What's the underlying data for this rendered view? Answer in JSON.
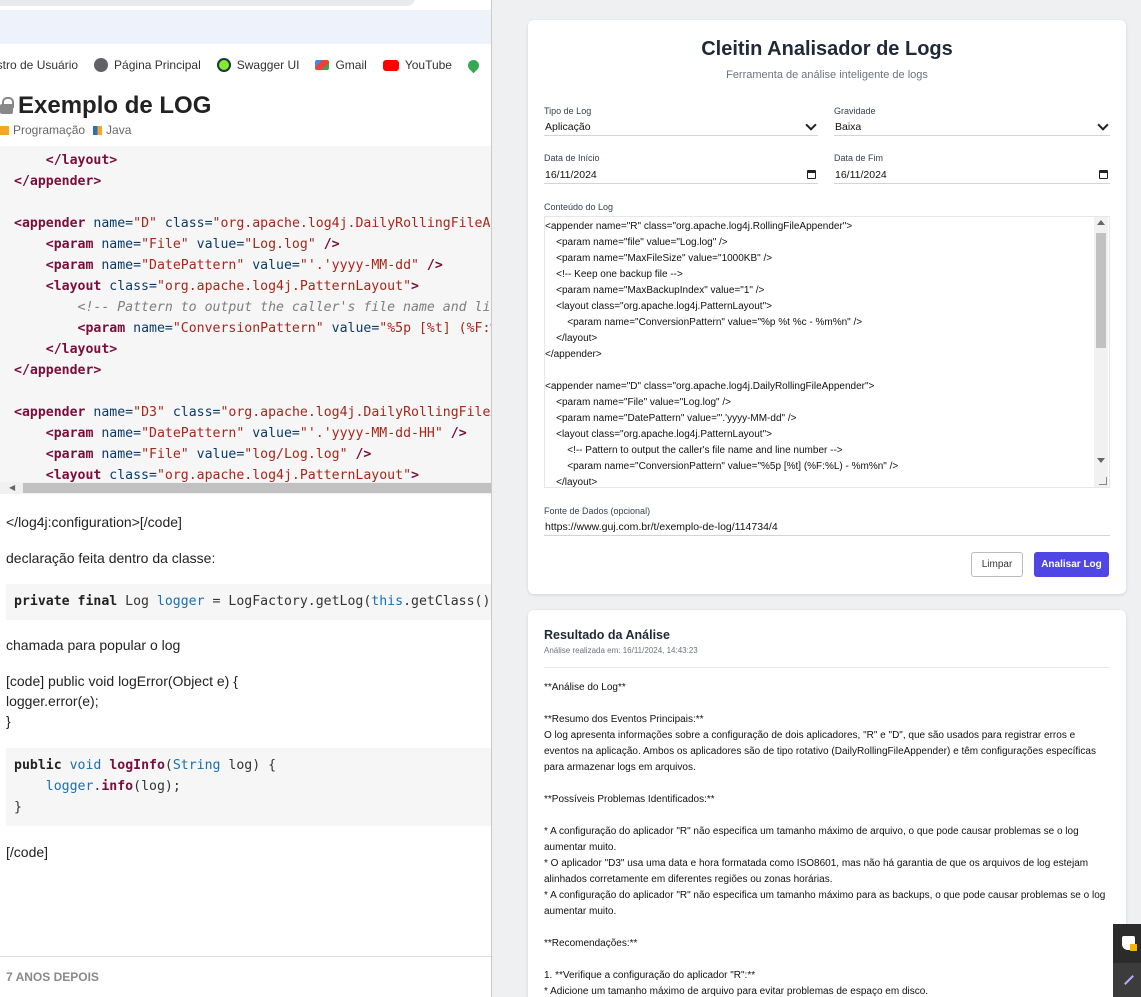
{
  "bookmarks": [
    {
      "label": "astro de Usuário",
      "icon": "user-icon",
      "color": "#5f6368"
    },
    {
      "label": "Página Principal",
      "icon": "globe-icon",
      "color": "#5f6368"
    },
    {
      "label": "Swagger UI",
      "icon": "swagger-icon",
      "color": "#85ea2d"
    },
    {
      "label": "Gmail",
      "icon": "gmail-icon",
      "color": "#ea4335"
    },
    {
      "label": "YouTube",
      "icon": "youtube-icon",
      "color": "#ff0000"
    }
  ],
  "post": {
    "title": "Exemplo de LOG",
    "categories": [
      {
        "label": "Programação",
        "color": "#f5a623"
      },
      {
        "label": "Java",
        "color": "#2f6fb6"
      }
    ],
    "p1": "</log4j:configuration>[/code]",
    "p2": "declaração feita dentro da classe:",
    "p3": "chamada para popular o log",
    "p4a": "[code] public void logError(Object e) {",
    "p4b": "logger.error(e);",
    "p4c": "}",
    "p5": "[/code]",
    "years_later": "7 ANOS DEPOIS"
  },
  "app": {
    "title": "Cleitin Analisador de Logs",
    "subtitle": "Ferramenta de análise inteligente de logs",
    "log_type_label": "Tipo de Log",
    "log_type_value": "Aplicação",
    "severity_label": "Gravidade",
    "severity_value": "Baixa",
    "start_label": "Data de Início",
    "start_value": "16/11/2024",
    "end_label": "Data de Fim",
    "end_value": "16/11/2024",
    "content_label": "Conteúdo do Log",
    "content_value": "<appender name=\"R\" class=\"org.apache.log4j.RollingFileAppender\">\n    <param name=\"file\" value=\"Log.log\" />\n    <param name=\"MaxFileSize\" value=\"1000KB\" />\n    <!-- Keep one backup file -->\n    <param name=\"MaxBackupIndex\" value=\"1\" />\n    <layout class=\"org.apache.log4j.PatternLayout\">\n        <param name=\"ConversionPattern\" value=\"%p %t %c - %m%n\" />\n    </layout>\n</appender>\n\n<appender name=\"D\" class=\"org.apache.log4j.DailyRollingFileAppender\">\n    <param name=\"File\" value=\"Log.log\" />\n    <param name=\"DatePattern\" value=\"'.'yyyy-MM-dd\" />\n    <layout class=\"org.apache.log4j.PatternLayout\">\n        <!-- Pattern to output the caller's file name and line number -->\n        <param name=\"ConversionPattern\" value=\"%5p [%t] (%F:%L) - %m%n\" />\n    </layout>",
    "source_label": "Fonte de Dados (opcional)",
    "source_value": "https://www.guj.com.br/t/exemplo-de-log/114734/4",
    "clear_label": "Limpar",
    "analyze_label": "Analisar Log",
    "accent": "#4f46e5"
  },
  "result": {
    "title": "Resultado da Análise",
    "timestamp": "Análise realizada em: 16/11/2024, 14:43:23",
    "body": "**Análise do Log**\n\n**Resumo dos Eventos Principais:**\nO log apresenta informações sobre a configuração de dois aplicadores, \"R\" e \"D\", que são usados para registrar erros e eventos na aplicação. Ambos os aplicadores são de tipo rotativo (DailyRollingFileAppender) e têm configurações específicas para armazenar logs em arquivos.\n\n**Possíveis Problemas Identificados:**\n\n* A configuração do aplicador \"R\" não especifica um tamanho máximo de arquivo, o que pode causar problemas se o log aumentar muito.\n* O aplicador \"D3\" usa uma data e hora formatada como ISO8601, mas não há garantia de que os arquivos de log estejam alinhados corretamente em diferentes regiões ou zonas horárias.\n* A configuração do aplicador \"R\" não especifica um tamanho máximo para as backups, o que pode causar problemas se o log aumentar muito.\n\n**Recomendações:**\n\n1. **Verifique a configuração do aplicador \"R\":**\n* Adicione um tamanho máximo de arquivo para evitar problemas de espaço em disco."
  }
}
